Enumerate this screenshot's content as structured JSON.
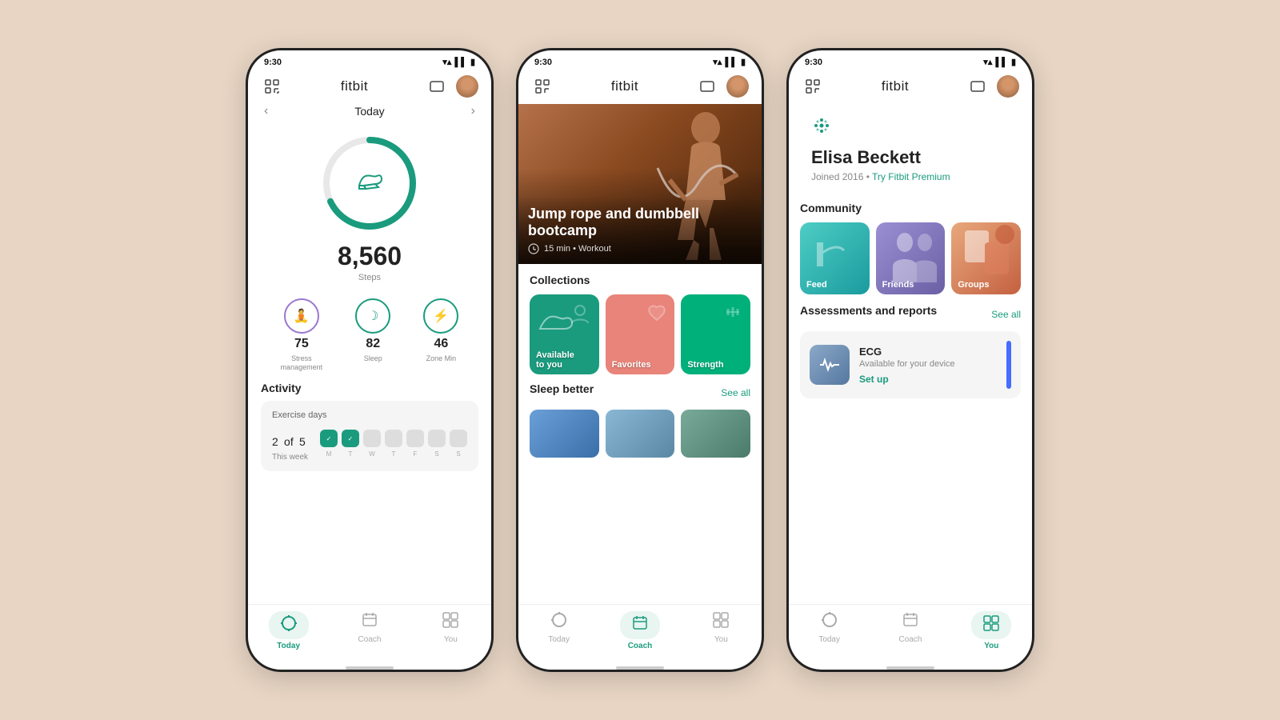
{
  "background": "#e8d5c4",
  "phone1": {
    "status_time": "9:30",
    "header_title": "fitbit",
    "nav_title": "Today",
    "steps_count": "8,560",
    "steps_label": "Steps",
    "metrics": [
      {
        "value": "75",
        "label": "Stress\nmanagement",
        "type": "purple",
        "icon": "🧘"
      },
      {
        "value": "82",
        "label": "Sleep",
        "type": "teal",
        "icon": "🌙"
      },
      {
        "value": "46",
        "label": "Zone Min",
        "type": "teal",
        "icon": "⚡"
      }
    ],
    "activity_title": "Activity",
    "exercise_card_title": "Exercise days",
    "exercise_count": "2",
    "exercise_of": "of",
    "exercise_total": "5",
    "exercise_week_label": "This week",
    "day_labels": [
      "M",
      "T",
      "W",
      "T",
      "F",
      "S",
      "S"
    ],
    "nav_items": [
      {
        "label": "Today",
        "active": true
      },
      {
        "label": "Coach",
        "active": false
      },
      {
        "label": "You",
        "active": false
      }
    ],
    "ring_progress_pct": 68
  },
  "phone2": {
    "status_time": "9:30",
    "header_title": "fitbit",
    "hero_title": "Jump rope and dumbbell bootcamp",
    "hero_duration": "15 min",
    "hero_type": "Workout",
    "collections_title": "Collections",
    "collection_items": [
      {
        "label": "Available\nto you",
        "bg": "teal"
      },
      {
        "label": "Favorites",
        "bg": "pink"
      },
      {
        "label": "Strength",
        "bg": "green"
      }
    ],
    "sleep_title": "Sleep better",
    "see_all_label": "See all",
    "nav_items": [
      {
        "label": "Today",
        "active": false
      },
      {
        "label": "Coach",
        "active": true
      },
      {
        "label": "You",
        "active": false
      }
    ]
  },
  "phone3": {
    "status_time": "9:30",
    "header_title": "fitbit",
    "profile_name": "Elisa Beckett",
    "profile_joined": "Joined 2016",
    "profile_premium_link": "Try Fitbit Premium",
    "community_title": "Community",
    "community_items": [
      {
        "label": "Feed",
        "bg": "feed"
      },
      {
        "label": "Friends",
        "bg": "friends"
      },
      {
        "label": "Groups",
        "bg": "groups"
      }
    ],
    "assessments_title": "Assessments and reports",
    "see_all_label": "See all",
    "ecg_title": "ECG",
    "ecg_subtitle": "Available for your device",
    "setup_label": "Set up",
    "nav_items": [
      {
        "label": "Today",
        "active": false
      },
      {
        "label": "Coach",
        "active": false
      },
      {
        "label": "You",
        "active": true
      }
    ]
  }
}
